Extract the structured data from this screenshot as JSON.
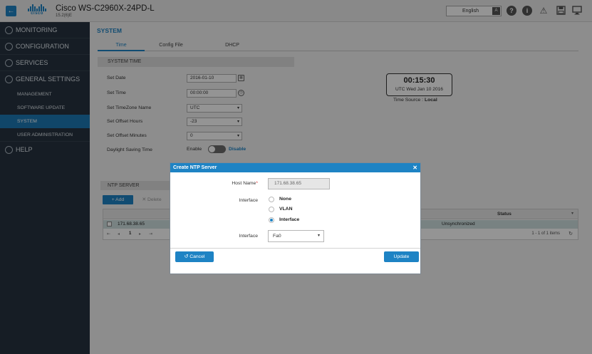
{
  "header": {
    "logo_text": "cisco",
    "device_title": "Cisco WS-C2960X-24PD-L",
    "device_version": "15.2(6)E",
    "language": "English"
  },
  "sidebar": {
    "sections": [
      {
        "label": "MONITORING",
        "icon": "dashboard-icon"
      },
      {
        "label": "CONFIGURATION",
        "icon": "wrench-icon"
      },
      {
        "label": "SERVICES",
        "icon": "key-icon"
      },
      {
        "label": "GENERAL SETTINGS",
        "icon": "gear-icon"
      }
    ],
    "general_items": [
      {
        "label": "MANAGEMENT"
      },
      {
        "label": "SOFTWARE UPDATE"
      },
      {
        "label": "SYSTEM"
      },
      {
        "label": "USER ADMINISTRATION"
      }
    ],
    "help": {
      "label": "HELP",
      "icon": "help-icon"
    }
  },
  "main": {
    "page_title": "SYSTEM",
    "tabs": [
      {
        "label": "Time"
      },
      {
        "label": "Config File"
      },
      {
        "label": "DHCP"
      }
    ],
    "system_time": {
      "section_title": "SYSTEM TIME",
      "set_date_label": "Set Date",
      "set_date_value": "2016-01-10",
      "set_time_label": "Set Time",
      "set_time_value": "00:00:00",
      "tz_label": "Set TimeZone Name",
      "tz_value": "UTC",
      "offset_hours_label": "Set Offset Hours",
      "offset_hours_value": "-23",
      "offset_minutes_label": "Set Offset Minutes",
      "offset_minutes_value": "0",
      "dst_label": "Daylight Saving Time",
      "dst_enable": "Enable",
      "dst_disable": "Disable"
    },
    "clock": {
      "time": "00:15:30",
      "date": "UTC Wed Jan 10 2016",
      "source_label": "Time Source :",
      "source_value": "Local"
    },
    "ntp": {
      "section_title": "NTP SERVER",
      "add_label": "+ Add",
      "delete_label": "✕ Delete",
      "columns": {
        "status": "Status"
      },
      "rows": [
        {
          "host": "171.68.38.65",
          "status": "Unsynchronized"
        }
      ],
      "pager": {
        "page": "1",
        "info": "1 - 1 of 1 items"
      }
    }
  },
  "modal": {
    "title": "Create NTP Server",
    "host_label": "Host Name",
    "host_required": "*",
    "host_value": "171.68.38.65",
    "interface_label": "Interface",
    "options": [
      {
        "label": "None",
        "checked": false
      },
      {
        "label": "VLAN",
        "checked": false
      },
      {
        "label": "Interface",
        "checked": true
      }
    ],
    "interface_select_label": "Interface",
    "interface_select_value": "Fa0",
    "cancel_label": "Cancel",
    "update_label": "Update"
  },
  "colors": {
    "accent": "#1e83c4",
    "sidebar_bg": "#263340",
    "active_nav": "#1c79b6"
  }
}
